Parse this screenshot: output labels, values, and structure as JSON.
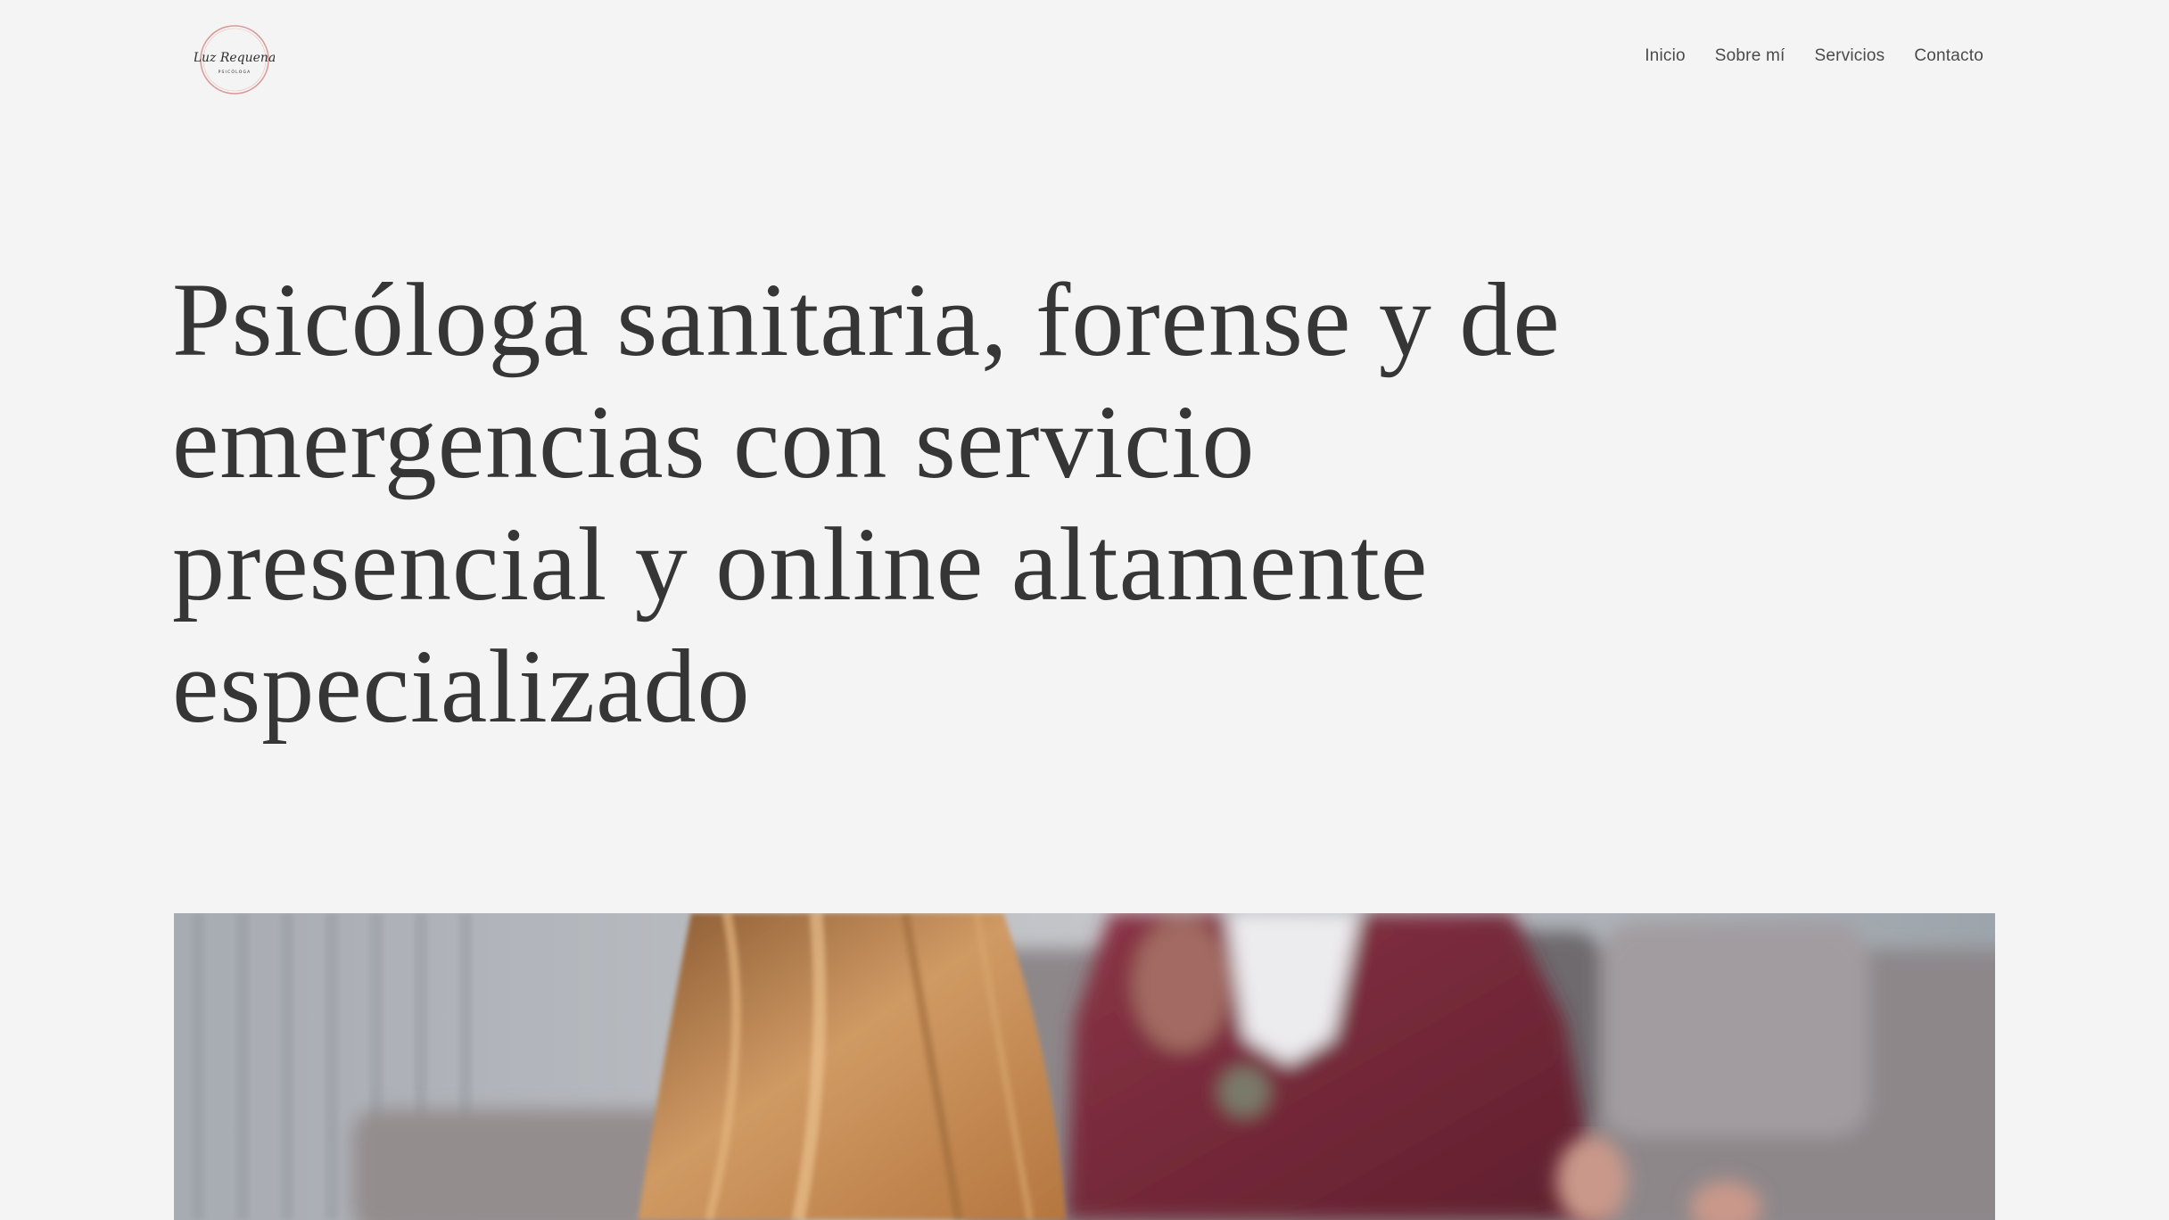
{
  "logo": {
    "script_text": "Luz Requena",
    "sub_text": "PSICÓLOGA",
    "icon": "logo-circle",
    "ring_color": "#d79a97"
  },
  "nav": {
    "items": [
      {
        "label": "Inicio"
      },
      {
        "label": "Sobre mí"
      },
      {
        "label": "Servicios"
      },
      {
        "label": "Contacto"
      }
    ]
  },
  "hero": {
    "title": "Psicóloga sanitaria, forense y de emergencias con servicio presencial y online altamente especializado"
  },
  "colors": {
    "background": "#f4f4f4",
    "text": "#363636",
    "jacket": "#7a2a3c",
    "hair": "#c98a52"
  }
}
